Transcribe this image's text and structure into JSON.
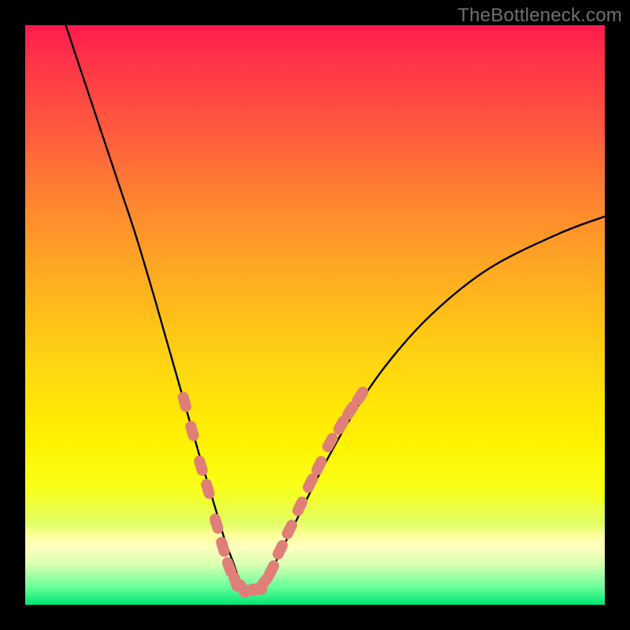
{
  "watermark": "TheBottleneck.com",
  "colors": {
    "frame": "#000000",
    "curve": "#000000",
    "marker_fill": "#e07f78",
    "marker_stroke": "#d66e67"
  },
  "chart_data": {
    "type": "line",
    "title": "",
    "xlabel": "",
    "ylabel": "",
    "xlim": [
      0,
      100
    ],
    "ylim": [
      0,
      100
    ],
    "grid": false,
    "legend": false,
    "series": [
      {
        "name": "bottleneck-curve",
        "x": [
          7,
          10,
          13,
          16,
          19,
          22,
          24,
          26,
          28,
          30,
          31.5,
          33,
          34.5,
          36,
          37,
          38,
          40,
          42,
          44,
          47,
          51,
          56,
          62,
          70,
          80,
          92,
          100
        ],
        "y": [
          100,
          91,
          82,
          73,
          64,
          54,
          47,
          40,
          33,
          26,
          21,
          16,
          11,
          7,
          4,
          2.5,
          2.5,
          5,
          9,
          15,
          23,
          32,
          41,
          50,
          58,
          64,
          67
        ]
      }
    ],
    "markers": [
      {
        "x": 27.5,
        "y": 35
      },
      {
        "x": 28.8,
        "y": 30
      },
      {
        "x": 30.3,
        "y": 24
      },
      {
        "x": 31.5,
        "y": 20
      },
      {
        "x": 33.0,
        "y": 14
      },
      {
        "x": 34.1,
        "y": 10
      },
      {
        "x": 35.2,
        "y": 6.5
      },
      {
        "x": 36.3,
        "y": 4
      },
      {
        "x": 37.5,
        "y": 2.8
      },
      {
        "x": 38.8,
        "y": 2.5
      },
      {
        "x": 40.0,
        "y": 2.7
      },
      {
        "x": 41.3,
        "y": 4
      },
      {
        "x": 42.5,
        "y": 6
      },
      {
        "x": 44.0,
        "y": 9.5
      },
      {
        "x": 45.6,
        "y": 13
      },
      {
        "x": 47.4,
        "y": 17
      },
      {
        "x": 49.2,
        "y": 21
      },
      {
        "x": 50.7,
        "y": 24
      },
      {
        "x": 52.6,
        "y": 28
      },
      {
        "x": 54.5,
        "y": 31
      },
      {
        "x": 56.1,
        "y": 33.5
      },
      {
        "x": 57.8,
        "y": 36
      }
    ]
  }
}
